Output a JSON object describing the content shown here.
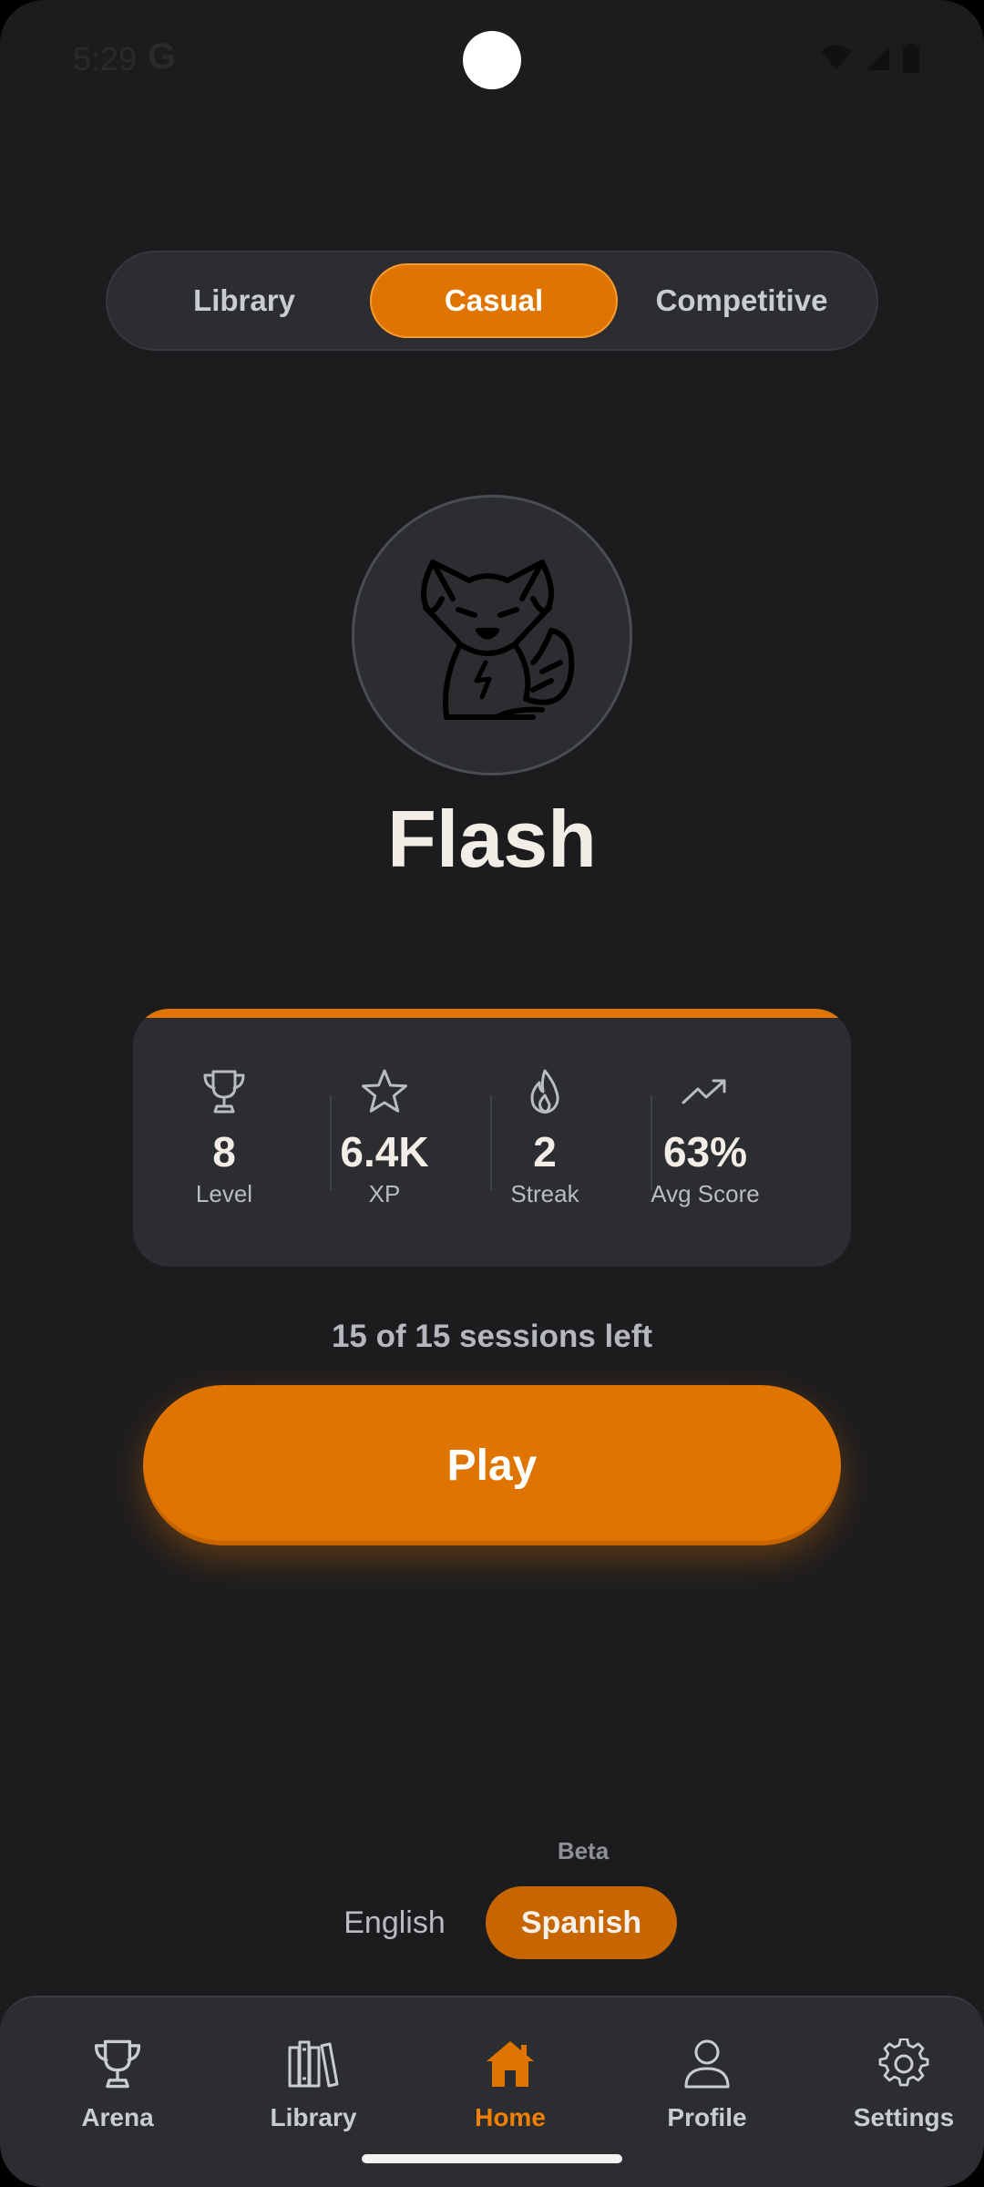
{
  "status_bar": {
    "time": "5:29",
    "g": "G"
  },
  "mode_tabs": [
    {
      "label": "Library",
      "active": false
    },
    {
      "label": "Casual",
      "active": true
    },
    {
      "label": "Competitive",
      "active": false
    }
  ],
  "avatar": {
    "icon": "fox-icon"
  },
  "profile": {
    "name": "Flash"
  },
  "stats": [
    {
      "icon": "trophy-icon",
      "value": "8",
      "label": "Level"
    },
    {
      "icon": "star-icon",
      "value": "6.4K",
      "label": "XP"
    },
    {
      "icon": "flame-icon",
      "value": "2",
      "label": "Streak"
    },
    {
      "icon": "trending-up-icon",
      "value": "63%",
      "label": "Avg Score"
    }
  ],
  "sessions_text": "15 of 15 sessions left",
  "play_label": "Play",
  "language": {
    "beta_label": "Beta",
    "options": [
      "English",
      "Spanish"
    ],
    "selected": "Spanish"
  },
  "nav": [
    {
      "label": "Arena",
      "icon": "trophy-icon",
      "active": false
    },
    {
      "label": "Library",
      "icon": "books-icon",
      "active": false
    },
    {
      "label": "Home",
      "icon": "home-icon",
      "active": true
    },
    {
      "label": "Profile",
      "icon": "person-icon",
      "active": false
    },
    {
      "label": "Settings",
      "icon": "gear-icon",
      "active": false
    }
  ],
  "colors": {
    "accent": "#e07400",
    "background": "#1c1c1e",
    "card": "#2b2d31"
  }
}
